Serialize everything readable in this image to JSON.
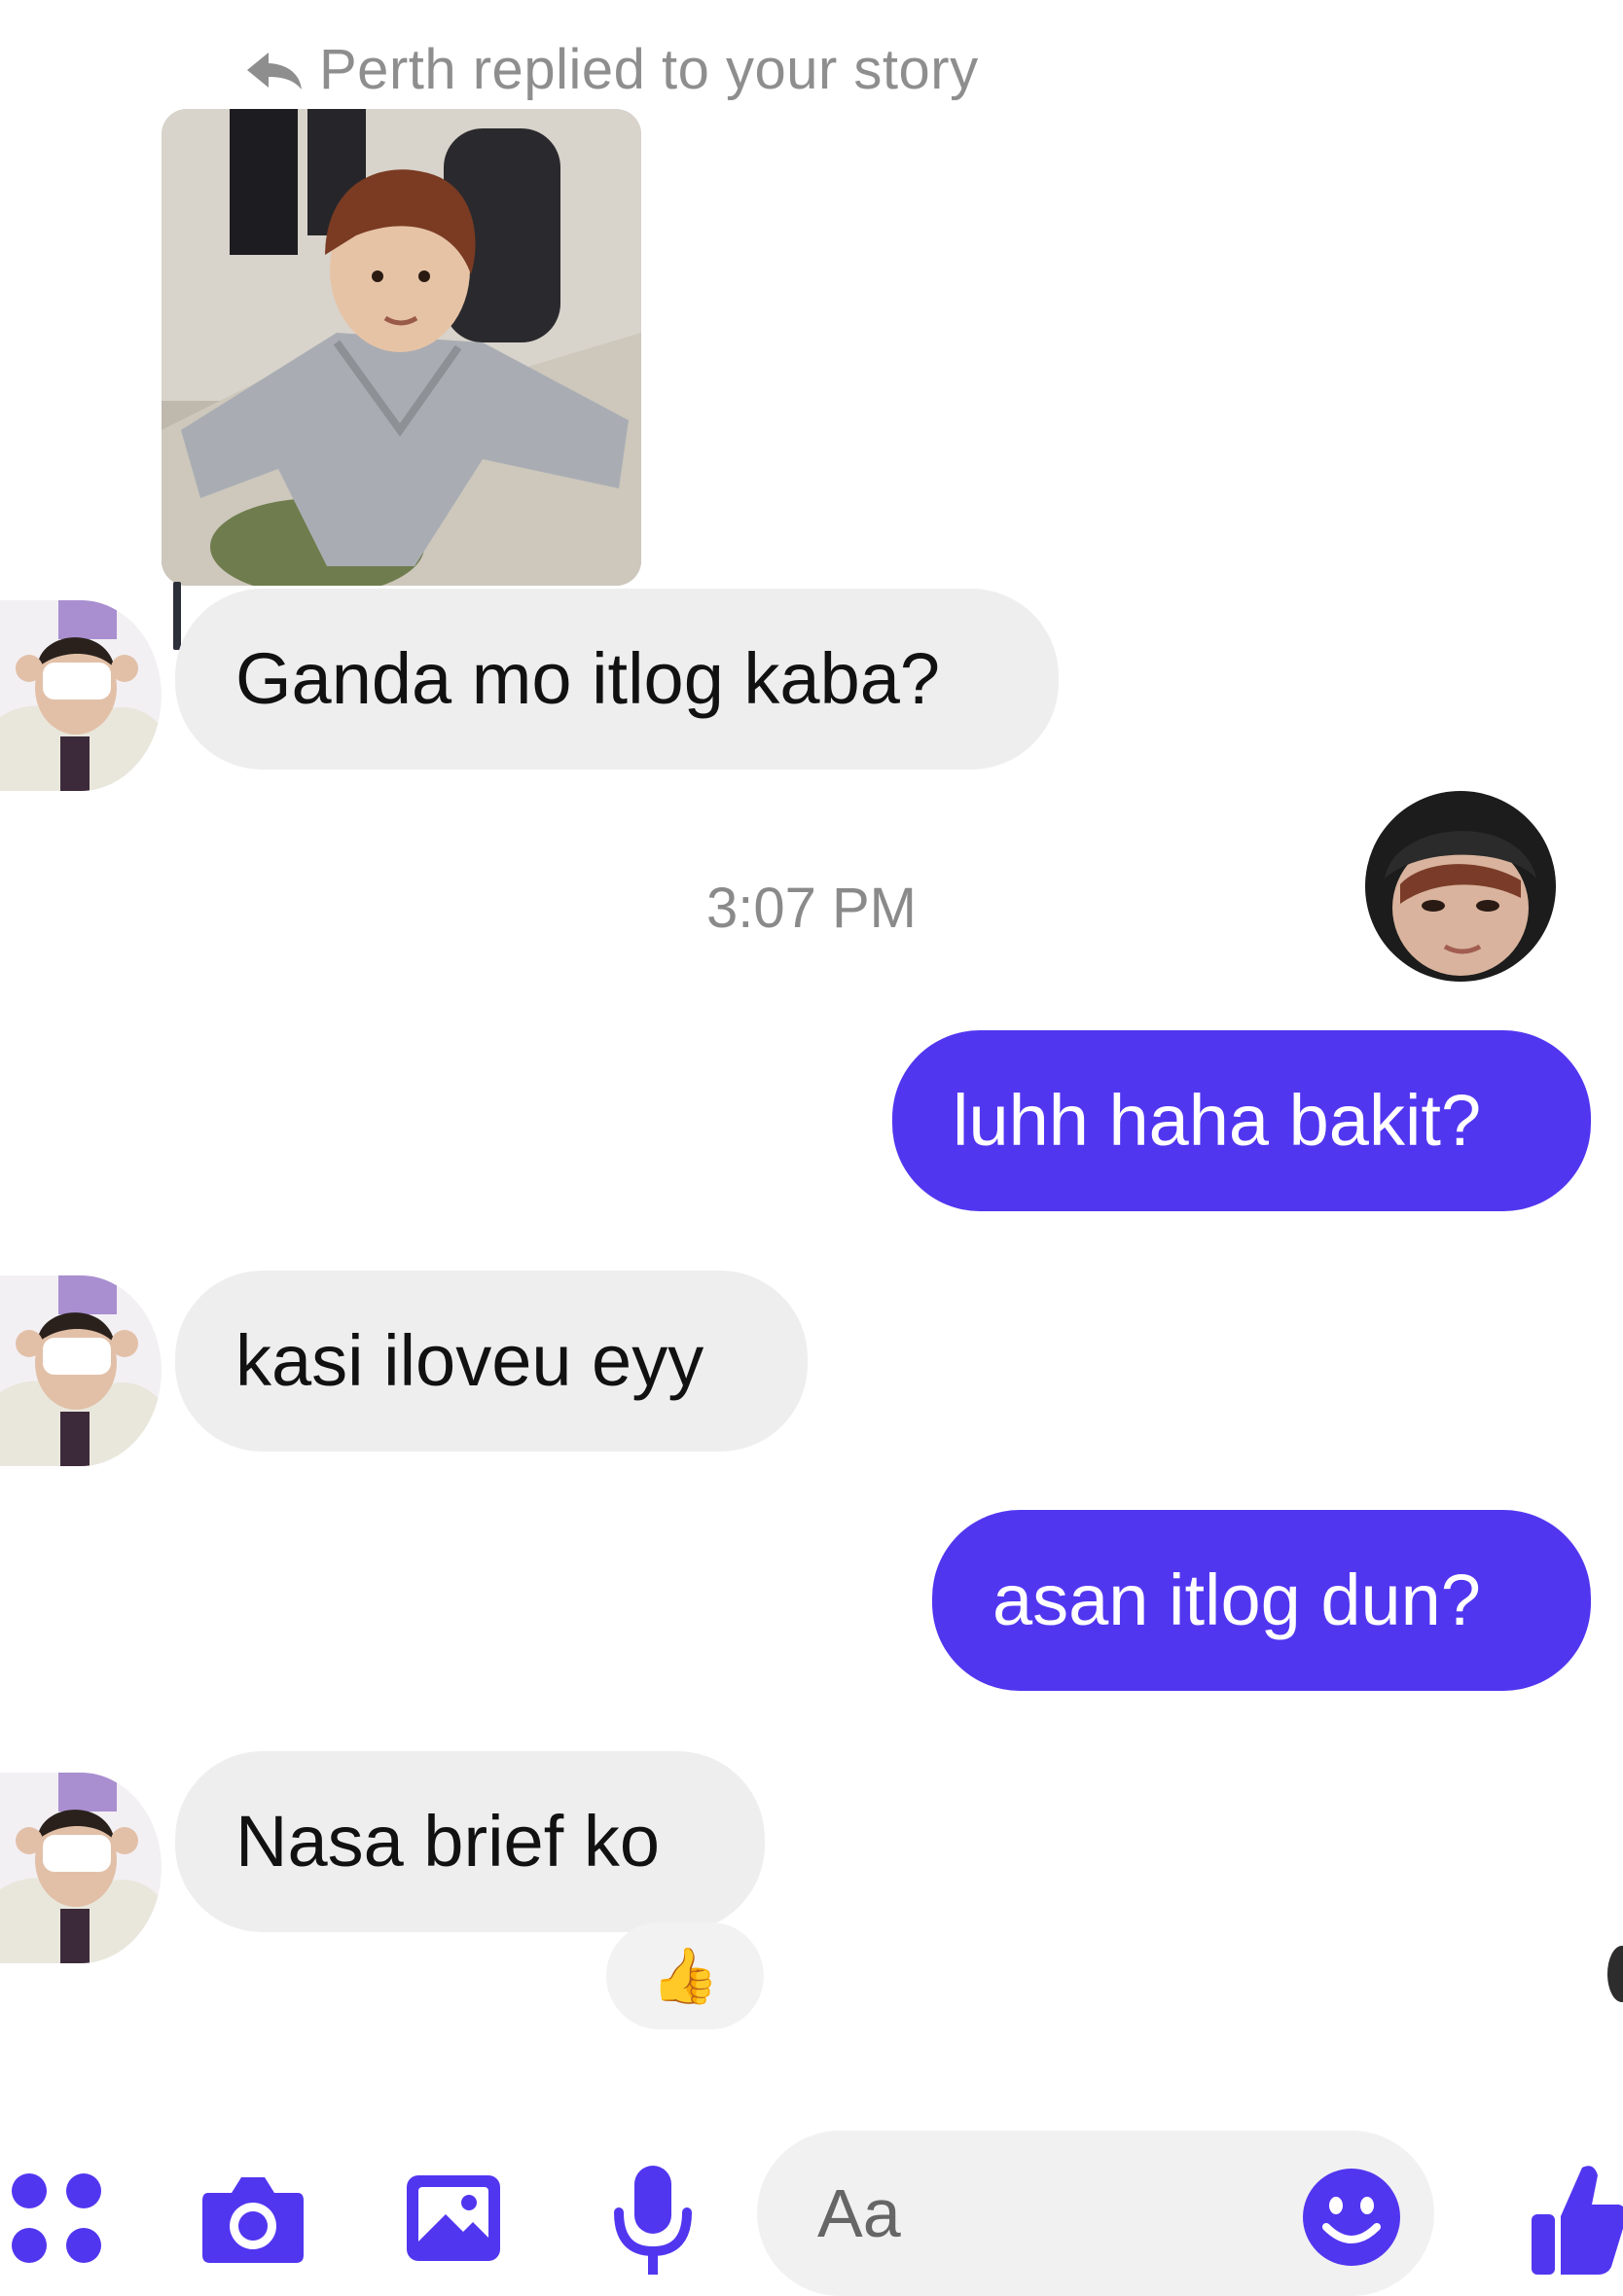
{
  "chat": {
    "reply_header": "Perth replied to your story",
    "timestamp": "3:07 PM",
    "messages": [
      {
        "side": "in",
        "text": "Ganda mo itlog kaba?"
      },
      {
        "side": "out",
        "text": "luhh haha bakit?"
      },
      {
        "side": "in",
        "text": "kasi iloveu eyy"
      },
      {
        "side": "out",
        "text": "asan itlog dun?"
      },
      {
        "side": "in",
        "text": "Nasa brief ko"
      }
    ],
    "reaction": "👍"
  },
  "composer": {
    "placeholder": "Aa",
    "icons": [
      "apps-icon",
      "camera-icon",
      "gallery-icon",
      "microphone-icon",
      "emoji-icon",
      "thumbs-up-icon"
    ]
  },
  "colors": {
    "accent": "#5136f0",
    "incoming_bubble": "#eeeeee",
    "muted_text": "#8e8e8e"
  }
}
